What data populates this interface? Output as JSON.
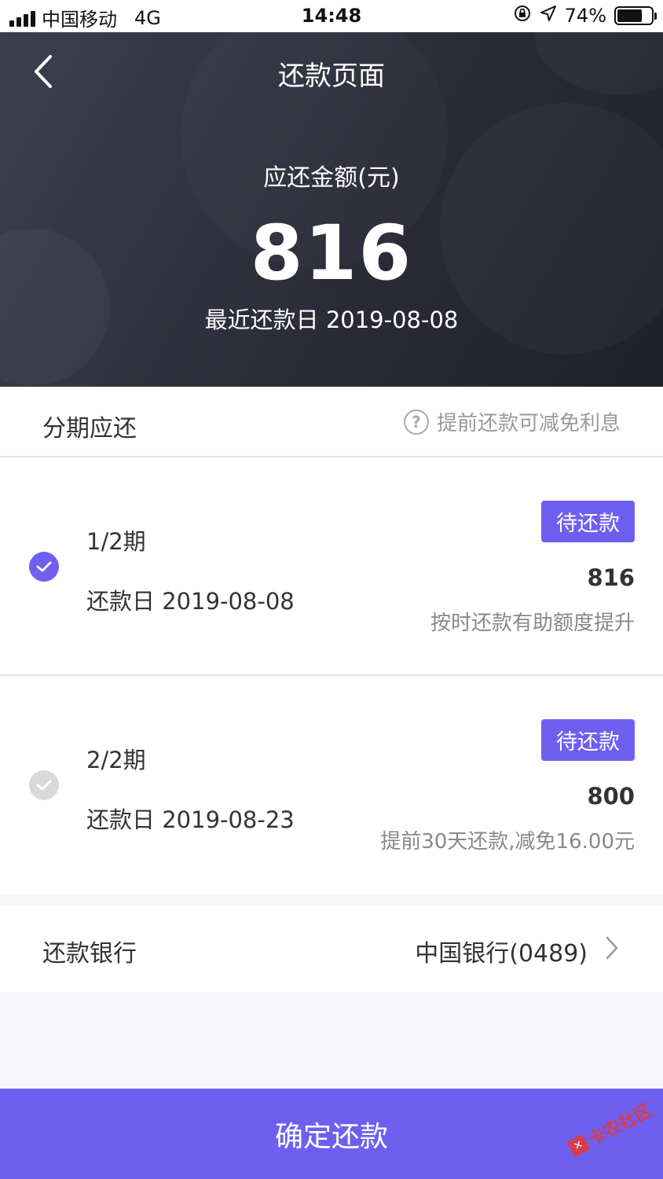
{
  "status_bar": {
    "carrier": "中国移动",
    "network": "4G",
    "time": "14:48",
    "battery": "74%",
    "battery_level": 0.74
  },
  "header": {
    "title": "还款页面",
    "amount_label": "应还金额(元)",
    "amount": "816",
    "due_date": "最近还款日 2019-08-08"
  },
  "installments": {
    "title": "分期应还",
    "tip": "提前还款可减免利息",
    "items": [
      {
        "period": "1/2期",
        "date": "还款日 2019-08-08",
        "status": "待还款",
        "amount": "816",
        "note": "按时还款有助额度提升",
        "checked": true
      },
      {
        "period": "2/2期",
        "date": "还款日 2019-08-23",
        "status": "待还款",
        "amount": "800",
        "note": "提前30天还款,减免16.00元",
        "checked": false
      }
    ]
  },
  "bank": {
    "label": "还款银行",
    "value": "中国银行(0489)"
  },
  "confirm_label": "确定还款",
  "watermark": "卡农社区",
  "colors": {
    "accent": "#6f5ff0",
    "header_bg": "#2b2c38",
    "unchecked": "#d9d9dc"
  }
}
